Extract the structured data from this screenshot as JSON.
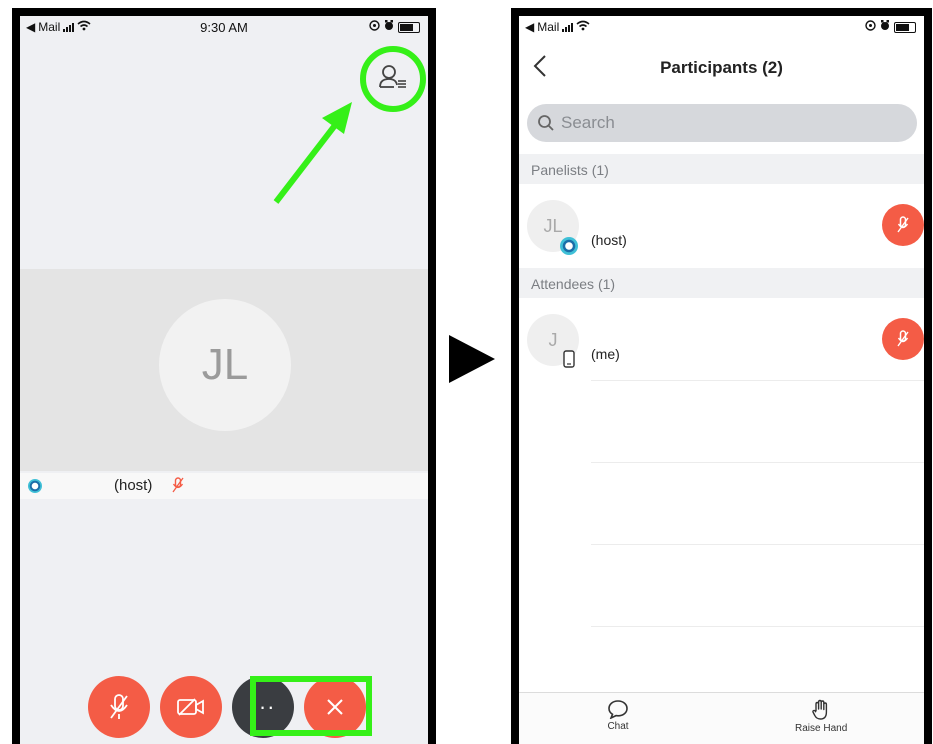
{
  "left_screen": {
    "status": {
      "back_app": "Mail",
      "time": "9:30 AM"
    },
    "avatar_initials": "JL",
    "host_label": "(host)"
  },
  "right_screen": {
    "status": {
      "back_app": "Mail"
    },
    "title": "Participants (2)",
    "search": {
      "placeholder": "Search"
    },
    "panelists_header": "Panelists (1)",
    "attendees_header": "Attendees (1)",
    "panelist": {
      "initials": "JL",
      "name": "(host)"
    },
    "attendee": {
      "initials": "J",
      "name": "(me)"
    },
    "tabs": {
      "chat": "Chat",
      "raise_hand": "Raise Hand"
    }
  },
  "colors": {
    "highlight_green": "#35f018",
    "mute_red": "#f45c46",
    "end_dark": "#3a3d41"
  }
}
